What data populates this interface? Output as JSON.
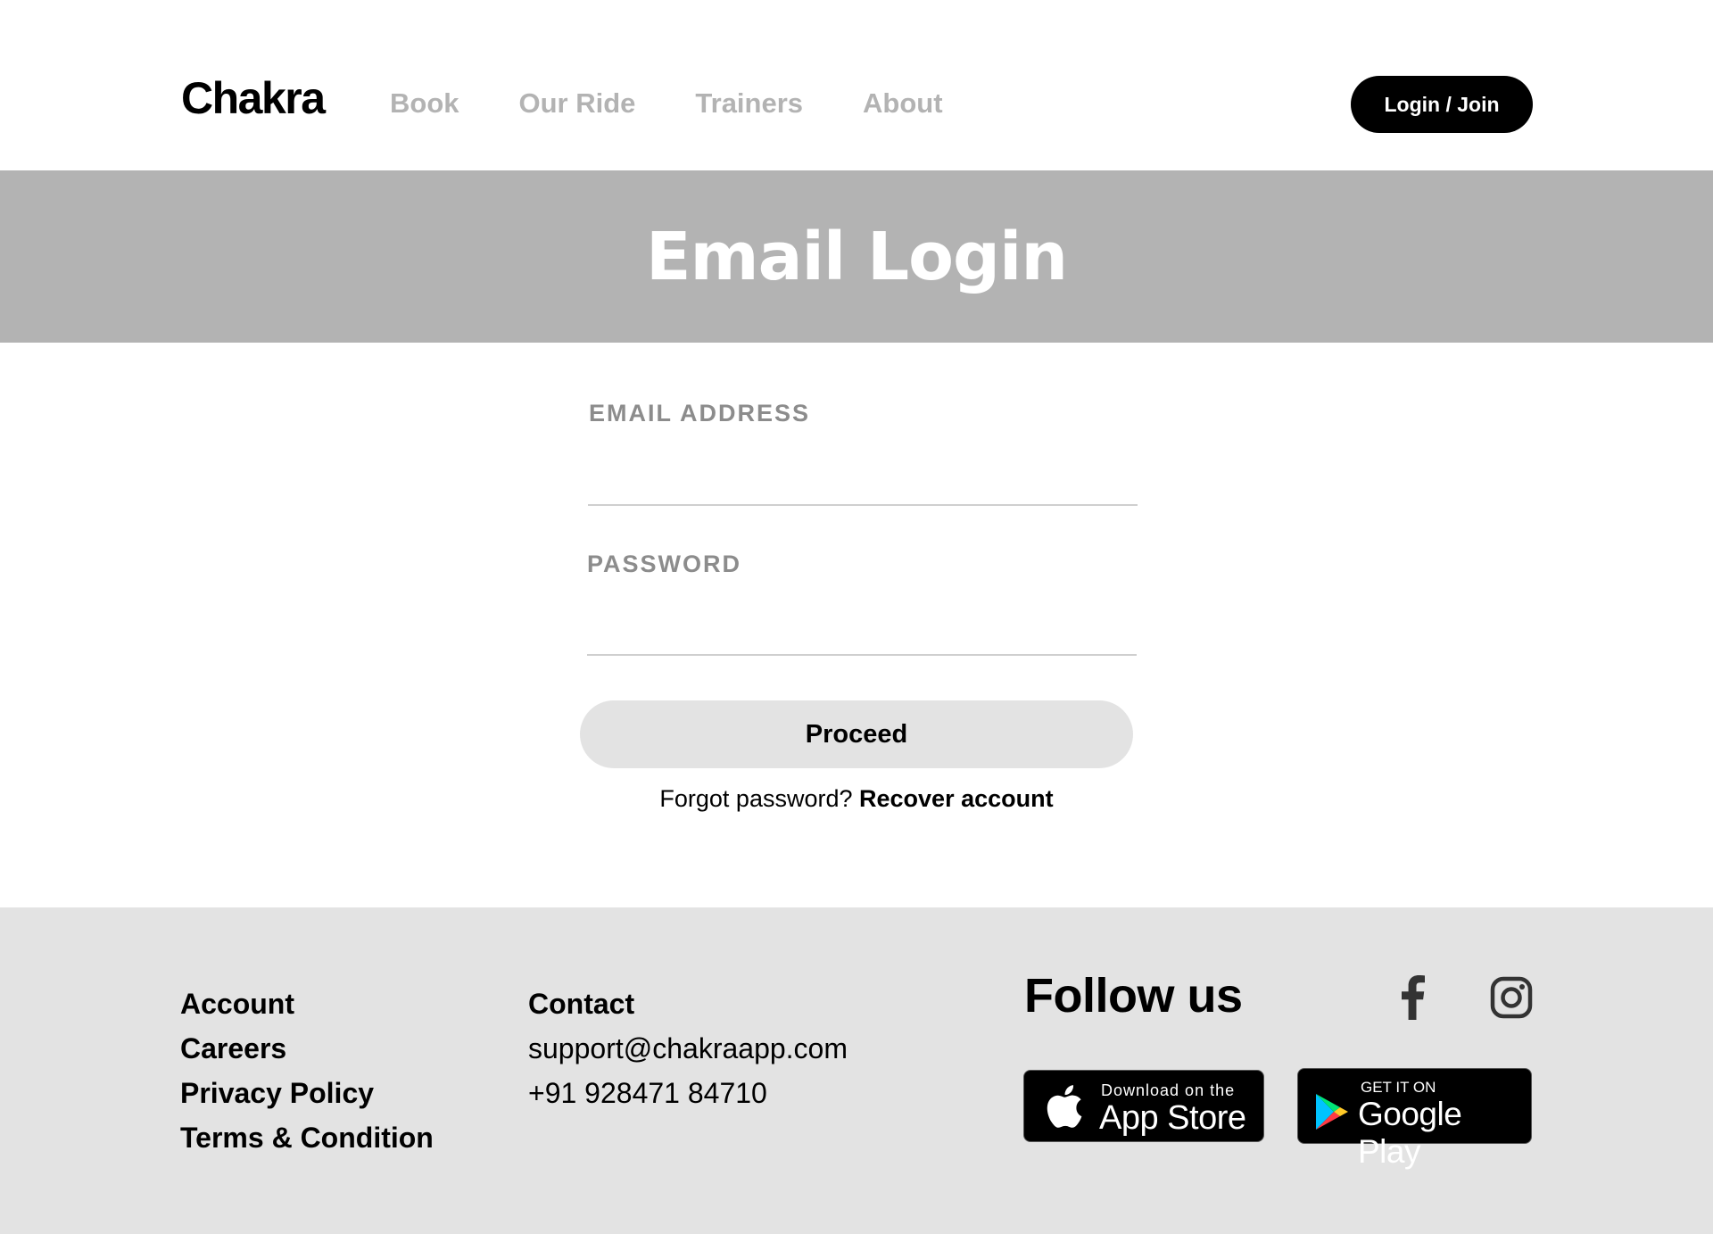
{
  "header": {
    "logo": "Chakra",
    "nav": [
      "Book",
      "Our Ride",
      "Trainers",
      "About"
    ],
    "login_label": "Login / Join"
  },
  "banner": {
    "title": "Email Login"
  },
  "form": {
    "email_label": "EMAIL ADDRESS",
    "email_value": "",
    "password_label": "PASSWORD",
    "password_value": "",
    "proceed_label": "Proceed",
    "forgot_text": "Forgot password?",
    "recover_link": "Recover account"
  },
  "footer": {
    "account_links": [
      "Account",
      "Careers",
      "Privacy Policy",
      "Terms & Condition"
    ],
    "contact_title": "Contact",
    "contact_email": "support@chakraapp.com",
    "contact_phone": "+91 928471 84710",
    "follow_title": "Follow us",
    "social_icons": [
      "facebook-icon",
      "instagram-icon"
    ],
    "app_store": {
      "small": "Download on the",
      "big": "App Store"
    },
    "google_play": {
      "small": "GET IT ON",
      "big": "Google Play"
    }
  },
  "colors": {
    "accent": "#000000",
    "banner_bg": "#b3b3b3",
    "footer_bg": "#e3e3e3",
    "nav_text": "#b3b3b3",
    "label_text": "#8c8c8c"
  }
}
